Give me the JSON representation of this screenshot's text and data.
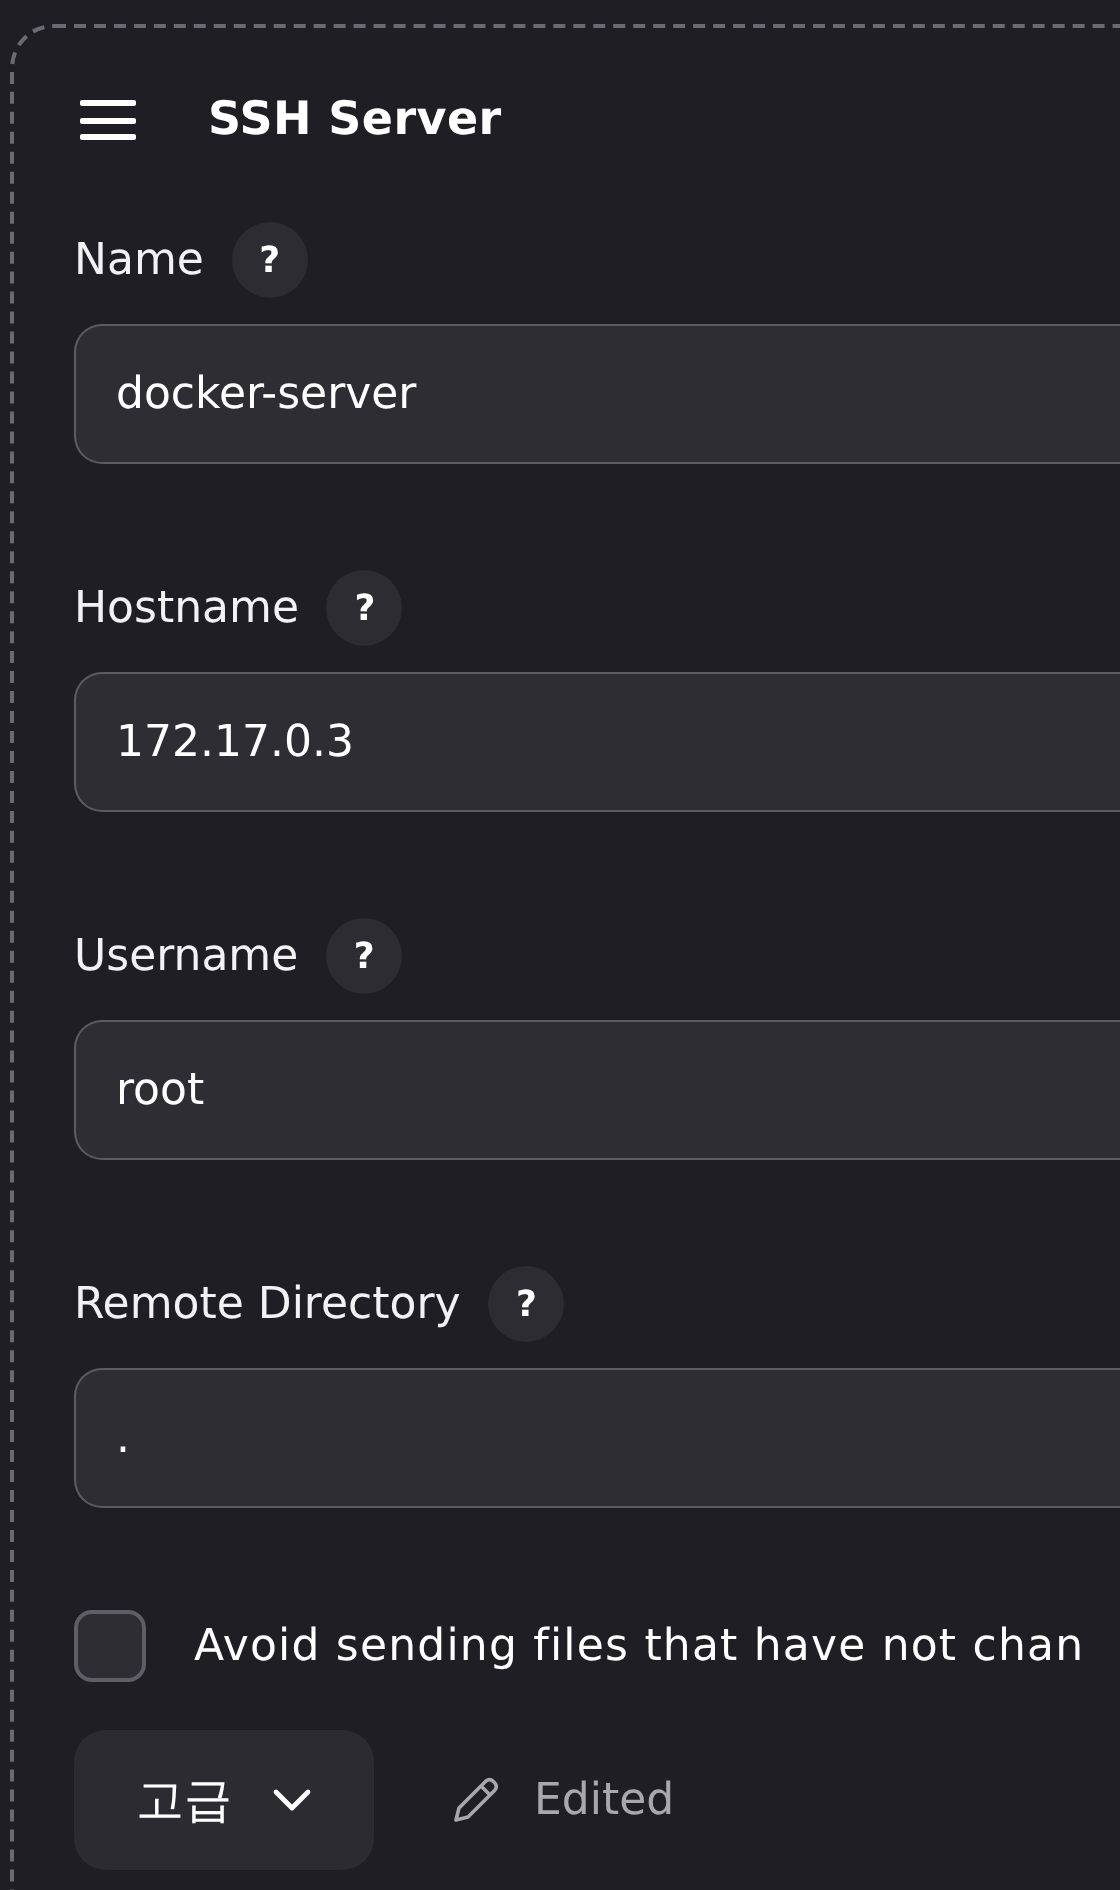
{
  "header": {
    "title": "SSH Server"
  },
  "fields": [
    {
      "label": "Name",
      "help": "?",
      "value": "docker-server"
    },
    {
      "label": "Hostname",
      "help": "?",
      "value": "172.17.0.3"
    },
    {
      "label": "Username",
      "help": "?",
      "value": "root"
    },
    {
      "label": "Remote Directory",
      "help": "?",
      "value": "."
    }
  ],
  "checkbox": {
    "label": "Avoid sending files that have not chan",
    "checked": false
  },
  "advanced_button": {
    "label": "고급"
  },
  "edit_status": {
    "label": "Edited"
  }
}
